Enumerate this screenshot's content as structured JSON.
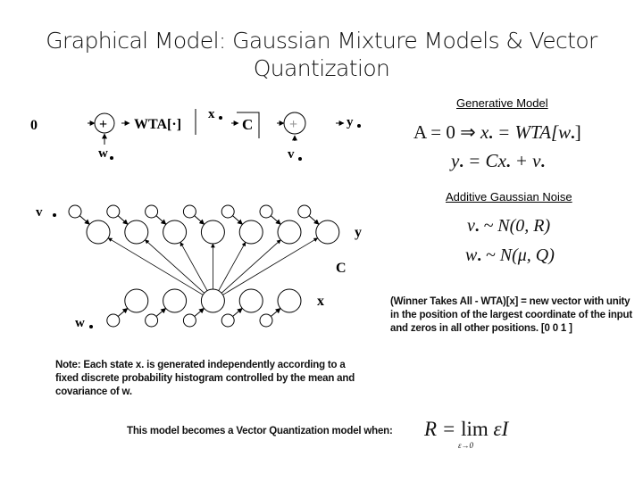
{
  "slide": {
    "title_line1": "Graphical Model: Gaussian Mixture Models & Vector",
    "title_line2": "Quantization"
  },
  "block_diagram": {
    "input_label": "0",
    "sum1_noise_label": "w",
    "wta_label": "WTA[·]",
    "state_label": "x",
    "matrix_label": "C",
    "sum2_noise_label": "v",
    "output_label": "y",
    "sum_symbol": "+"
  },
  "network_diagram": {
    "top_noise_label": "v",
    "bottom_noise_label": "w",
    "output_layer_label": "y",
    "weights_label": "C",
    "hidden_layer_label": "x",
    "output_node_count": 7,
    "hidden_node_count": 5,
    "active_hidden_node_index": 2
  },
  "generative_model": {
    "heading": "Generative Model",
    "eq1_lhs": "A = 0",
    "eq1_implies": "⇒",
    "eq1_rhs_var": "x",
    "eq1_rhs": "= WTA[w",
    "eq1_close": "]",
    "eq2_lhs": "y",
    "eq2_mid": "= Cx",
    "eq2_plus": "+ v"
  },
  "noise": {
    "heading": "Additive Gaussian Noise",
    "eq1_var": "v",
    "eq1_rhs": "~ N(0, R)",
    "eq2_var": "w",
    "eq2_rhs": "~ N(μ, Q)"
  },
  "wta_note": "(Winner Takes All - WTA)[x] = new vector with unity in the position of the largest coordinate of the input and zeros in all other positions. [0 0 1 ]",
  "state_note": "Note: Each state x. is generated independently according to a fixed discrete probability histogram controlled by the mean and covariance of w.",
  "vq_condition": {
    "text": "This model becomes a Vector Quantization model when:",
    "formula": "R = lim εI",
    "formula_lhs": "R =",
    "formula_lim": "lim",
    "formula_tail": "εI",
    "limit_sub": "ε→0"
  }
}
